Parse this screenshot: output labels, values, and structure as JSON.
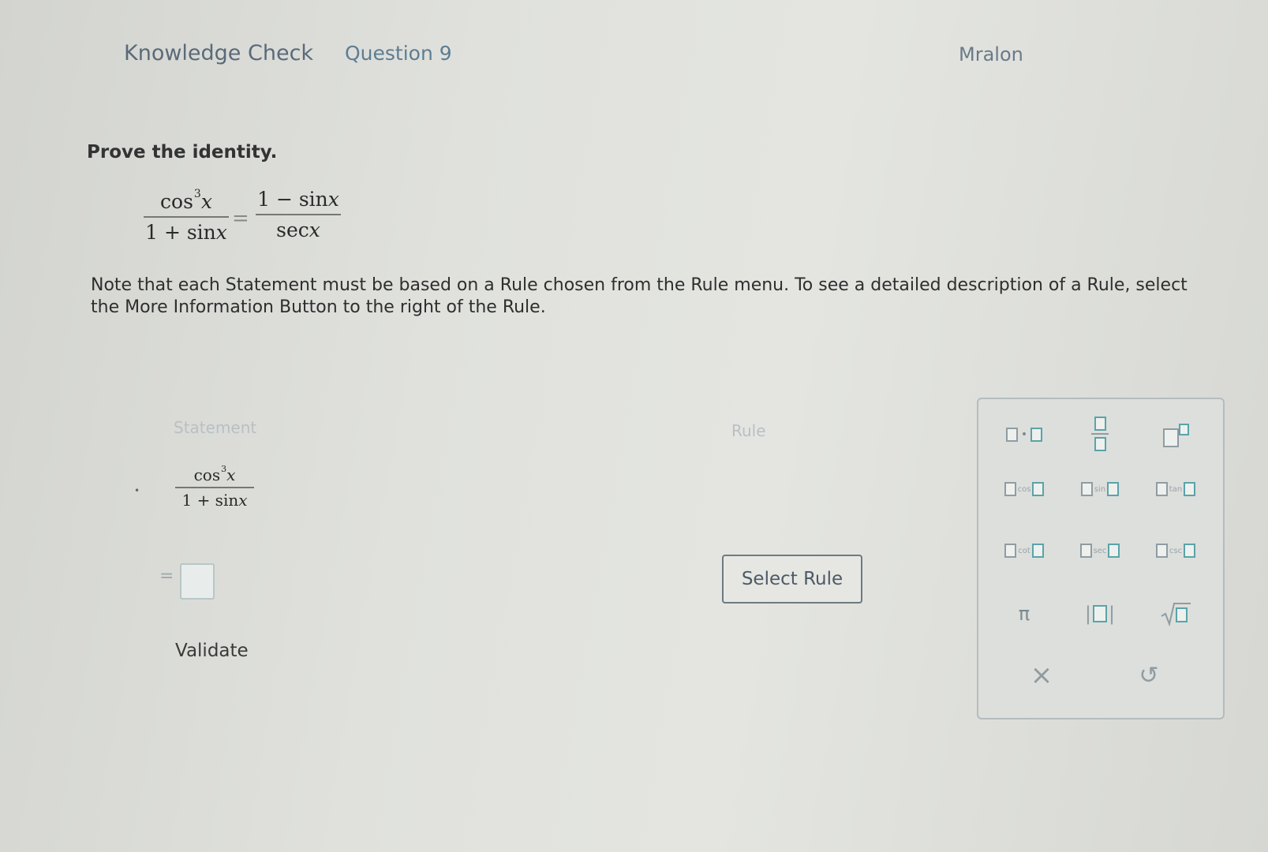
{
  "header": {
    "title": "Knowledge Check",
    "question": "Question 9",
    "user": "Mralon"
  },
  "problem": {
    "instruction": "Prove the identity.",
    "identity": {
      "lhs_num_func": "cos",
      "lhs_num_exp": "3",
      "lhs_num_var": "x",
      "lhs_den": "1 + sin",
      "lhs_den_var": "x",
      "equals": "=",
      "rhs_num": "1 − sin",
      "rhs_num_var": "x",
      "rhs_den": "sec",
      "rhs_den_var": "x"
    },
    "note": "Note that each Statement must be based on a Rule chosen from the Rule menu. To see a detailed description of a Rule, select the More Information Button to the right of the Rule."
  },
  "proof_table": {
    "statement_header": "Statement",
    "rule_header": "Rule",
    "first_statement": {
      "num_func": "cos",
      "num_exp": "3",
      "num_var": "x",
      "den": "1 + sin",
      "den_var": "x"
    },
    "equals": "=",
    "select_rule_label": "Select Rule",
    "validate_label": "Validate"
  },
  "palette": {
    "cos_label": "cos",
    "sin_label": "sin",
    "tan_label": "tan",
    "cot_label": "cot",
    "sec_label": "sec",
    "csc_label": "csc",
    "pi_label": "π",
    "clear_label": "×",
    "undo_label": "↺"
  }
}
